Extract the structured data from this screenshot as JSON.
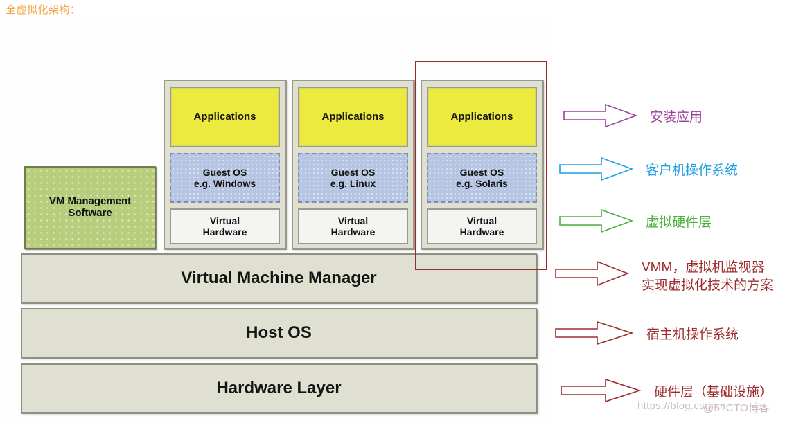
{
  "page": {
    "title": "全虚拟化架构："
  },
  "diagram": {
    "vm_management": "VM Management\nSoftware",
    "vm_management_line1": "VM Management",
    "vm_management_line2": "Software",
    "columns": [
      {
        "applications": "Applications",
        "guest_os_line1": "Guest OS",
        "guest_os_line2": "e.g. Windows",
        "virtual_hardware_line1": "Virtual",
        "virtual_hardware_line2": "Hardware"
      },
      {
        "applications": "Applications",
        "guest_os_line1": "Guest OS",
        "guest_os_line2": "e.g. Linux",
        "virtual_hardware_line1": "Virtual",
        "virtual_hardware_line2": "Hardware"
      },
      {
        "applications": "Applications",
        "guest_os_line1": "Guest OS",
        "guest_os_line2": "e.g. Solaris",
        "virtual_hardware_line1": "Virtual",
        "virtual_hardware_line2": "Hardware"
      }
    ],
    "layers": [
      {
        "label": "Virtual Machine Manager"
      },
      {
        "label": "Host OS"
      },
      {
        "label": "Hardware Layer"
      }
    ]
  },
  "annotations": [
    {
      "label": "安装应用",
      "color": "#9b3f9b",
      "arrow": "right-arrow-icon"
    },
    {
      "label": "客户机操作系统",
      "color": "#1e9fe0",
      "arrow": "right-arrow-icon"
    },
    {
      "label": "虚拟硬件层",
      "color": "#4cae3e",
      "arrow": "right-arrow-icon"
    },
    {
      "label_line1": "VMM，虚拟机监视器",
      "label_line2": "实现虚拟化技术的方案",
      "color": "#9e2b2b",
      "arrow": "right-arrow-icon"
    },
    {
      "label": "宿主机操作系统",
      "color": "#9e2b2b",
      "arrow": "right-arrow-icon"
    },
    {
      "label": "硬件层（基础设施）",
      "color": "#9e2b2b",
      "arrow": "right-arrow-icon"
    }
  ],
  "watermark": {
    "url": "https://blog.csdn.n",
    "brand": "@51CTO博客"
  },
  "colors": {
    "title": "#f5a142",
    "applications": "#ece93f",
    "guest_os": "#b6c6e2",
    "virtual_hardware": "#f4f4f2",
    "vm_management": "#b9cd7f",
    "layer": "#dfe0d2",
    "highlight": "#9e2b2b"
  }
}
